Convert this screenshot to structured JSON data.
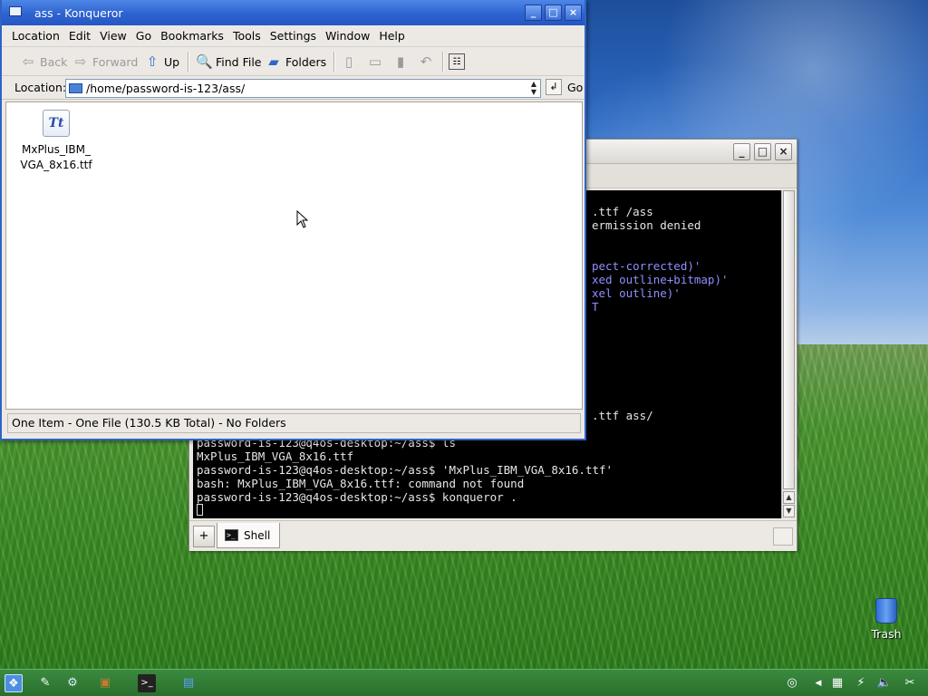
{
  "konqueror": {
    "title": "ass - Konqueror",
    "menu": [
      "Location",
      "Edit",
      "View",
      "Go",
      "Bookmarks",
      "Tools",
      "Settings",
      "Window",
      "Help"
    ],
    "toolbar": {
      "back": "Back",
      "forward": "Forward",
      "up": "Up",
      "find_file": "Find File",
      "folders": "Folders"
    },
    "location_label": "Location:",
    "location_value": "/home/password-is-123/ass/",
    "go_label": "Go",
    "file": {
      "name": "MxPlus_IBM_VGA_8x16.ttf",
      "name_line1": "MxPlus_IBM_",
      "name_line2": "VGA_8x16.ttf",
      "icon_glyph": "Tt"
    },
    "status": "One Item - One File (130.5 KB Total) - No Folders"
  },
  "terminal": {
    "tab_label": "Shell",
    "lines_partial": [
      {
        "text": ".ttf /ass",
        "color": "#e6e6e6"
      },
      {
        "text": "ermission denied",
        "color": "#e6e6e6"
      },
      {
        "text": "pect-corrected)'",
        "color": "#8f8fff"
      },
      {
        "text": "xed outline+bitmap)'",
        "color": "#8f8fff"
      },
      {
        "text": "xel outline)'",
        "color": "#8f8fff"
      },
      {
        "text": "T",
        "color": "#8f8fff"
      },
      {
        "text": ".ttf ass/",
        "color": "#e6e6e6"
      }
    ],
    "lines_full": [
      "password-is-123@q4os-desktop:~/ass$ ls",
      "MxPlus_IBM_VGA_8x16.ttf",
      "password-is-123@q4os-desktop:~/ass$ 'MxPlus_IBM_VGA_8x16.ttf'",
      "bash: MxPlus_IBM_VGA_8x16.ttf: command not found",
      "password-is-123@q4os-desktop:~/ass$ konqueror ."
    ]
  },
  "desktop": {
    "trash_label": "Trash"
  },
  "colors": {
    "konq_title": "#2d63d0",
    "terminal_bg": "#000000",
    "taskbar": "#2f7a33"
  }
}
